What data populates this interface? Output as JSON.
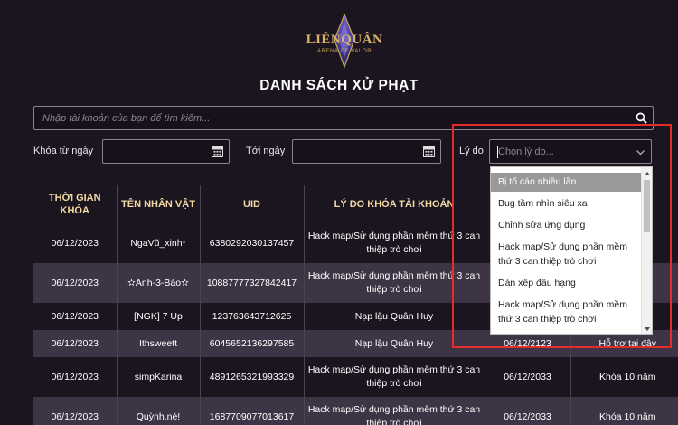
{
  "logo": {
    "word": "LIÊNQUÂN",
    "sub": "ARENA OF VALOR"
  },
  "page_title": "DANH SÁCH XỬ PHẠT",
  "search": {
    "placeholder": "Nhập tài khoản của bạn để tìm kiếm..."
  },
  "filters": {
    "from_label": "Khóa từ ngày",
    "to_label": "Tới ngày",
    "reason_label": "Lý do",
    "reason_placeholder": "Chọn lý do..."
  },
  "reason_options": [
    "Bị tố cáo nhiều lần",
    "Bug tầm nhìn siêu xa",
    "Chỉnh sửa ứng dụng",
    "Hack map/Sử dụng phần mềm thứ 3 can thiệp trò chơi",
    "Dàn xếp đấu hạng",
    "Hack map/Sử dụng phần mềm thứ 3 can thiệp trò chơi"
  ],
  "table": {
    "headers": [
      "THỜI GIAN KHÓA",
      "TÊN NHÂN VẬT",
      "UID",
      "LÝ DO KHÓA TÀI KHOẢN",
      "",
      ""
    ],
    "rows": [
      {
        "date": "06/12/2023",
        "name": "NgaVũ_xinh*",
        "uid": "6380292030137457",
        "reason": "Hack map/Sử dụng phần mêm thứ 3 can thiệp trò chơi",
        "until": "",
        "action": ""
      },
      {
        "date": "06/12/2023",
        "name": "✫Anh-3-Báo✫",
        "uid": "10887777327842417",
        "reason": "Hack map/Sử dụng phần mêm thứ 3 can thiệp trò chơi",
        "until": "",
        "action": ""
      },
      {
        "date": "06/12/2023",
        "name": "[NGK] 7 Up",
        "uid": "123763643712625",
        "reason": "Nạp lậu Quân Huy",
        "until": "",
        "action": ""
      },
      {
        "date": "06/12/2023",
        "name": "Ithsweett",
        "uid": "6045652136297585",
        "reason": "Nạp lậu Quân Huy",
        "until": "06/12/2123",
        "action": "Hỗ trợ tại đây"
      },
      {
        "date": "06/12/2023",
        "name": "simpKarina",
        "uid": "4891265321993329",
        "reason": "Hack map/Sử dụng phần mêm thứ 3 can thiệp trò chơi",
        "until": "06/12/2033",
        "action": "Khóa 10 năm"
      },
      {
        "date": "06/12/2023",
        "name": "Quỳnh.nè!",
        "uid": "1687709077013617",
        "reason": "Hack map/Sử dụng phần mêm thứ 3 can thiệp trò chơi",
        "until": "06/12/2033",
        "action": "Khóa 10 năm"
      }
    ]
  },
  "colors": {
    "background": "#1b1520",
    "header_text": "#f3d9a4",
    "alt_row": "#3d3545",
    "highlight_frame": "#e82a2a",
    "link": "#7f8ef2"
  }
}
